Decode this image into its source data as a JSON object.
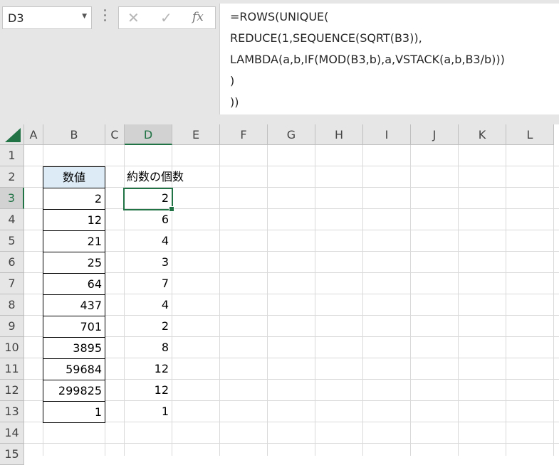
{
  "name_box": {
    "value": "D3"
  },
  "formula_bar": {
    "cancel_glyph": "✕",
    "enter_glyph": "✓",
    "fx_label": "fx",
    "lines": [
      "=ROWS(UNIQUE(",
      "REDUCE(1,SEQUENCE(SQRT(B3)),",
      "LAMBDA(a,b,IF(MOD(B3,b),a,VSTACK(a,b,B3/b)))",
      ")",
      "))"
    ]
  },
  "columns": [
    "A",
    "B",
    "C",
    "D",
    "E",
    "F",
    "G",
    "H",
    "I",
    "J",
    "K",
    "L"
  ],
  "rows": [
    "1",
    "2",
    "3",
    "4",
    "5",
    "6",
    "7",
    "8",
    "9",
    "10",
    "11",
    "12",
    "13",
    "14",
    "15"
  ],
  "selected": {
    "column": "D",
    "row": "3"
  },
  "sheet": {
    "b_header": "数値",
    "d_header": "約数の個数",
    "b_values": [
      "2",
      "12",
      "21",
      "25",
      "64",
      "437",
      "701",
      "3895",
      "59684",
      "299825",
      "1"
    ],
    "d_values": [
      "2",
      "6",
      "4",
      "3",
      "7",
      "4",
      "2",
      "8",
      "12",
      "12",
      "1"
    ]
  },
  "colors": {
    "accent": "#217346",
    "header_fill": "#ddebf7"
  }
}
